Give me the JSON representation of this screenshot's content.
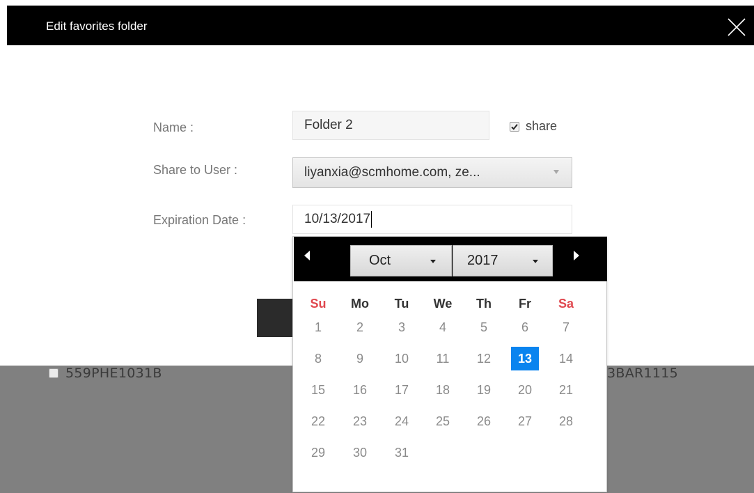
{
  "dialog": {
    "title": "Edit favorites folder",
    "close_icon": "close-icon"
  },
  "form": {
    "name_label": "Name :",
    "name_value": "Folder 2",
    "share_label": "share",
    "share_checked": true,
    "share_to_label": "Share to User :",
    "share_to_value": "liyanxia@scmhome.com, ze...",
    "expiration_label": "Expiration Date :",
    "expiration_value": "10/13/2017"
  },
  "background": {
    "item_left": "559PHE1031B",
    "item_right": "3BAR1115"
  },
  "datepicker": {
    "month": "Oct",
    "year": "2017",
    "weekdays": [
      "Su",
      "Mo",
      "Tu",
      "We",
      "Th",
      "Fr",
      "Sa"
    ],
    "first_weekday_index": 0,
    "days_in_month": 31,
    "selected_day": 13,
    "selected_color": "#0a84ef",
    "weekend_color": "#e0484f"
  }
}
